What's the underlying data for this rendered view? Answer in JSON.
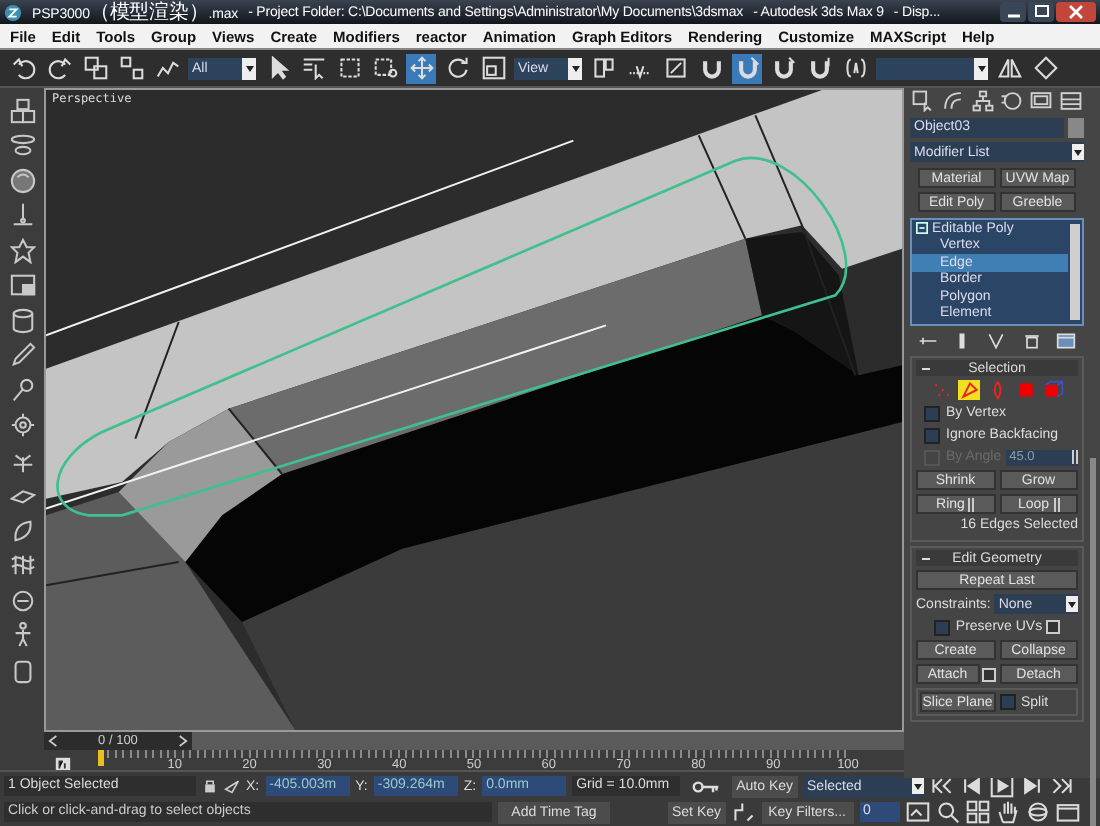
{
  "window": {
    "title": [
      "PSP3000（模型渲染）.max",
      "- Project Folder: C:\\Documents and Settings\\Administrator\\My Documents\\3dsmax",
      "- Autodesk 3ds Max 9",
      "- Disp..."
    ]
  },
  "menu": [
    "File",
    "Edit",
    "Tools",
    "Group",
    "Views",
    "Create",
    "Modifiers",
    "reactor",
    "Animation",
    "Graph Editors",
    "Rendering",
    "Customize",
    "MAXScript",
    "Help"
  ],
  "toolbar": [
    {
      "kind": "undo",
      "selected": false
    },
    {
      "kind": "redo",
      "selected": false
    },
    {
      "kind": "link",
      "selected": false
    },
    {
      "kind": "unlink",
      "selected": false
    },
    {
      "kind": "bind",
      "selected": false
    },
    {
      "kind": "dropdown",
      "value": "All"
    },
    {
      "kind": "select",
      "selected": false
    },
    {
      "kind": "select-by-name",
      "selected": false
    },
    {
      "kind": "region",
      "selected": false
    },
    {
      "kind": "crossing",
      "selected": false
    },
    {
      "kind": "move",
      "selected": true
    },
    {
      "kind": "rotate",
      "selected": false
    },
    {
      "kind": "scale",
      "selected": false
    },
    {
      "kind": "dropdown",
      "value": "View"
    },
    {
      "kind": "pivot",
      "selected": false
    },
    {
      "kind": "manipulate",
      "selected": false
    },
    {
      "kind": "toggle",
      "selected": false
    },
    {
      "kind": "snap",
      "selected": false
    },
    {
      "kind": "angle-snap",
      "selected": true
    },
    {
      "kind": "percent-snap",
      "selected": false
    },
    {
      "kind": "spinner-snap",
      "selected": false
    },
    {
      "kind": "named-selection",
      "selected": false
    },
    {
      "kind": "wide-dropdown"
    },
    {
      "kind": "mirror",
      "selected": false
    },
    {
      "kind": "align",
      "selected": false
    }
  ],
  "viewport": {
    "label": "Perspective"
  },
  "time_slider": {
    "label": "0 / 100",
    "level": 0
  },
  "track": {
    "labels": [
      "10",
      "20",
      "30",
      "40",
      "50",
      "60",
      "70",
      "80",
      "90",
      "100"
    ]
  },
  "command_panel": {
    "object_name": "Object03",
    "modifier_list": "Modifier List",
    "modifier_buttons": [
      "Material",
      "UVW Map",
      "Edit Poly",
      "Greeble"
    ],
    "modifier_stack": [
      {
        "label": "Editable Poly",
        "expanded": true,
        "selected": false,
        "children": [
          {
            "label": "Vertex",
            "selected": false
          },
          {
            "label": "Edge",
            "selected": true
          },
          {
            "label": "Border",
            "selected": false
          },
          {
            "label": "Polygon",
            "selected": false
          },
          {
            "label": "Element",
            "selected": false
          }
        ]
      }
    ]
  },
  "selection": {
    "title": "Selection",
    "expanded": true,
    "levels": [
      {
        "kind": "vertex",
        "selected": false
      },
      {
        "kind": "edge",
        "selected": true
      },
      {
        "kind": "border",
        "selected": false
      },
      {
        "kind": "polygon",
        "selected": false
      },
      {
        "kind": "element",
        "selected": false
      }
    ],
    "options": [
      {
        "label": "By Vertex",
        "checked": false,
        "disabled": false
      },
      {
        "label": "Ignore Backfacing",
        "checked": false,
        "disabled": false
      },
      {
        "label": "By Angle",
        "checked": false,
        "disabled": true,
        "value": "45.0"
      }
    ],
    "shrink": "Shrink",
    "grow": "Grow",
    "ring": "Ring",
    "loop": "Loop",
    "summary": "16 Edges Selected"
  },
  "edit_geometry": {
    "title": "Edit Geometry",
    "expanded": true,
    "repeat": "Repeat Last",
    "constraints_label": "Constraints:",
    "constraints_value": "None",
    "preserve_uvs": {
      "label": "Preserve UVs",
      "checked": false
    },
    "create": "Create",
    "collapse": "Collapse",
    "attach": "Attach",
    "detach": "Detach",
    "slice_plane": "Slice Plane",
    "split": {
      "label": "Split",
      "checked": false
    }
  },
  "status": {
    "selection": "1 Object Selected",
    "x_label": "X:",
    "x": "-405.003m",
    "y_label": "Y:",
    "y": "-309.264m",
    "z_label": "Z:",
    "z": "0.0mm",
    "grid": "Grid = 10.0mm",
    "prompt": "Click or click-and-drag to select objects",
    "add_time_tag": "Add Time Tag",
    "auto_key": {
      "label": "Auto Key",
      "on": false
    },
    "key_mode": "Selected",
    "set_key": "Set Key",
    "key_filters": "Key Filters...",
    "frame": "0"
  }
}
